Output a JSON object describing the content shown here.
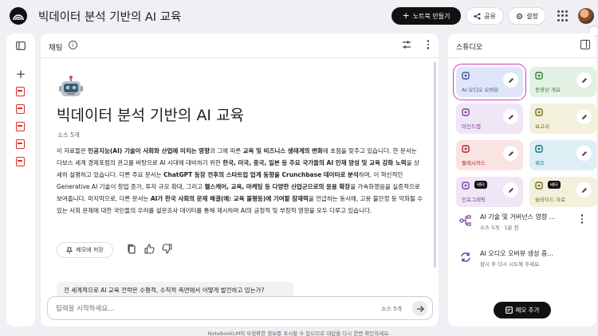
{
  "header": {
    "title": "빅데이터 분석 기반의 AI 교육",
    "new_notebook_label": "노트북 만들기",
    "share_label": "공유",
    "settings_label": "설정"
  },
  "chat": {
    "panel_title": "채팅",
    "notebook_title": "빅데이터 분석 기반의 AI 교육",
    "source_count": "소스 5개",
    "summary": {
      "s1": "이 자료들은 ",
      "b1": "인공지능(AI) 기술이 사회와 산업에 미치는 영향",
      "s2": "과 그에 따른 ",
      "b2": "교육 및 비즈니스 생태계의 변화",
      "s3": "에 초점을 맞추고 있습니다. 한 문서는 다보스 세계 경제포럼의 권고를 바탕으로 AI 시대에 대비하기 위한 ",
      "b3": "한국, 미국, 중국, 일본 등 주요 국가들의 AI 인재 양성 및 교육 강화 노력",
      "s4": "을 상세히 설명하고 있습니다. 다른 주요 문서는 ",
      "b4": "ChatGPT 등장 전후의 스타트업 업계 동향을 Crunchbase 데이터로 분석",
      "s5": "하며, 이 혁신적인 Generative AI 기술이 창업 증가, 투자 규모 확대, 그리고 ",
      "b5": "헬스케어, 교육, 마케팅 등 다양한 산업군으로의 응용 확장",
      "s6": "을 가속화했음을 실증적으로 보여줍니다. 마지막으로, 다른 문서는 ",
      "b6": "AI가 한국 사회의 문제 해결(예: 교육 불평등)에 기여할 잠재력",
      "s7": "을 언급하는 동시에, 고용 불안정 등 악화될 수 있는 사회 문제에 대한 국민들의 우려를 설문조사 데이터를 통해 제시하며 AI의 긍정적 및 부정적 영향을 모두 다루고 있습니다."
    },
    "save_memo_label": "메모에 저장",
    "suggestion": "전 세계적으로 AI 교육 전략은 수평적, 수직적 측면에서 어떻게 발전하고 있는가?",
    "input_placeholder": "입력을 시작하세요...",
    "input_source_count": "소스 5개",
    "disclaimer": "NotebookLM이 부정확한 정보를 표시할 수 있으므로 대답을 다시 한번 확인하세요."
  },
  "studio": {
    "title": "스튜디오",
    "tiles": [
      {
        "label": "AI 오디오 오버뷰",
        "bg": "#dfe6f7",
        "fg": "#3955a3",
        "icon": "sparkle-icon",
        "badge": ""
      },
      {
        "label": "동영상 개요",
        "bg": "#e3f1e4",
        "fg": "#2f7a3a",
        "icon": "video-icon",
        "badge": ""
      },
      {
        "label": "마인드맵",
        "bg": "#efe6f6",
        "fg": "#7b3fa0",
        "icon": "mindmap-icon",
        "badge": ""
      },
      {
        "label": "보고서",
        "bg": "#f3f0dc",
        "fg": "#7a6a1f",
        "icon": "report-icon",
        "badge": ""
      },
      {
        "label": "플래시카드",
        "bg": "#f9e3e3",
        "fg": "#b3261e",
        "icon": "flashcards-icon",
        "badge": ""
      },
      {
        "label": "퀴즈",
        "bg": "#ddeff4",
        "fg": "#1f6f86",
        "icon": "quiz-icon",
        "badge": ""
      },
      {
        "label": "인포그래픽",
        "bg": "#efe6f6",
        "fg": "#7b3fa0",
        "icon": "infographic-icon",
        "badge": "베타"
      },
      {
        "label": "슬라이드 자료",
        "bg": "#f3f0dc",
        "fg": "#7a6a1f",
        "icon": "slides-icon",
        "badge": "베타"
      }
    ],
    "notes": [
      {
        "title": "AI 기술 및 거버넌스 영향 ...",
        "sub": "소스 5개 · 1분 전"
      },
      {
        "title": "AI 오디오 오버뷰 생성 중...",
        "sub": "잠시 후 다시 시도해 주세요."
      }
    ],
    "add_memo_label": "메모 추가"
  }
}
